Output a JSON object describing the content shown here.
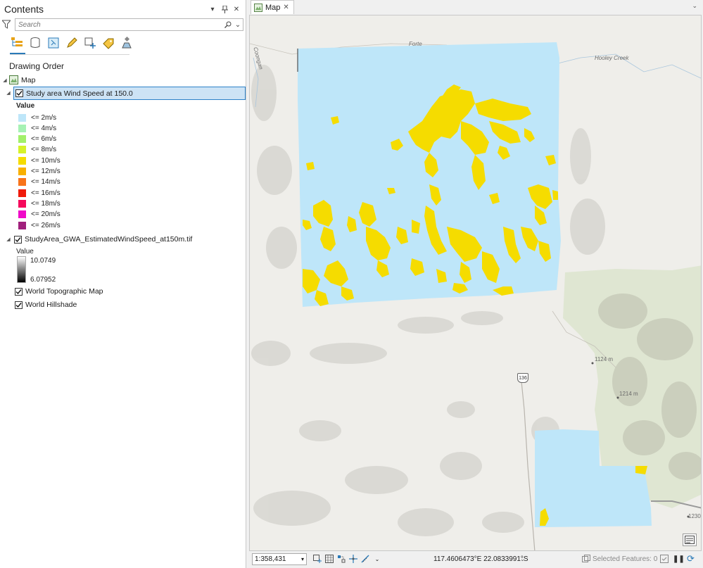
{
  "contents": {
    "title": "Contents",
    "search_placeholder": "Search",
    "drawing_order": "Drawing Order",
    "map_node": "Map",
    "layer1": {
      "label": "Study area Wind Speed at 150.0",
      "value_header": "Value",
      "legend": [
        {
          "label": "<= 2m/s",
          "color": "#bee6f9"
        },
        {
          "label": "<= 4m/s",
          "color": "#a6f2b4"
        },
        {
          "label": "<= 6m/s",
          "color": "#a2f06a"
        },
        {
          "label": "<= 8m/s",
          "color": "#d6f22a"
        },
        {
          "label": "<= 10m/s",
          "color": "#f5dc00"
        },
        {
          "label": "<= 12m/s",
          "color": "#f8b000"
        },
        {
          "label": "<= 14m/s",
          "color": "#f8741a"
        },
        {
          "label": "<= 16m/s",
          "color": "#f01a0a"
        },
        {
          "label": "<= 18m/s",
          "color": "#f50a5c"
        },
        {
          "label": "<= 20m/s",
          "color": "#f00ac8"
        },
        {
          "label": "<= 26m/s",
          "color": "#a0207c"
        }
      ]
    },
    "layer2": {
      "label": "StudyArea_GWA_EstimatedWindSpeed_at150m.tif",
      "value_header": "Value",
      "high": "10.0749",
      "low": "6.07952"
    },
    "layer3": {
      "label": "World Topographic Map"
    },
    "layer4": {
      "label": "World Hillshade"
    }
  },
  "map": {
    "tab_label": "Map",
    "labels": {
      "creek": "Hooley Creek",
      "elev1": "1124 m",
      "elev2": "1214 m",
      "elev3": "1230",
      "road": "136",
      "river": "Coongan",
      "fortescue": "Forte"
    }
  },
  "status": {
    "scale": "1:358,431",
    "coordinates": "117.4606473°E 22.0833991°S",
    "selected_features": "Selected Features: 0"
  },
  "colors": {
    "accent": "#2a7ab8",
    "selection_bg": "#cde3f5",
    "wind_low": "#bee6f9",
    "wind_mid": "#f5dc00"
  }
}
